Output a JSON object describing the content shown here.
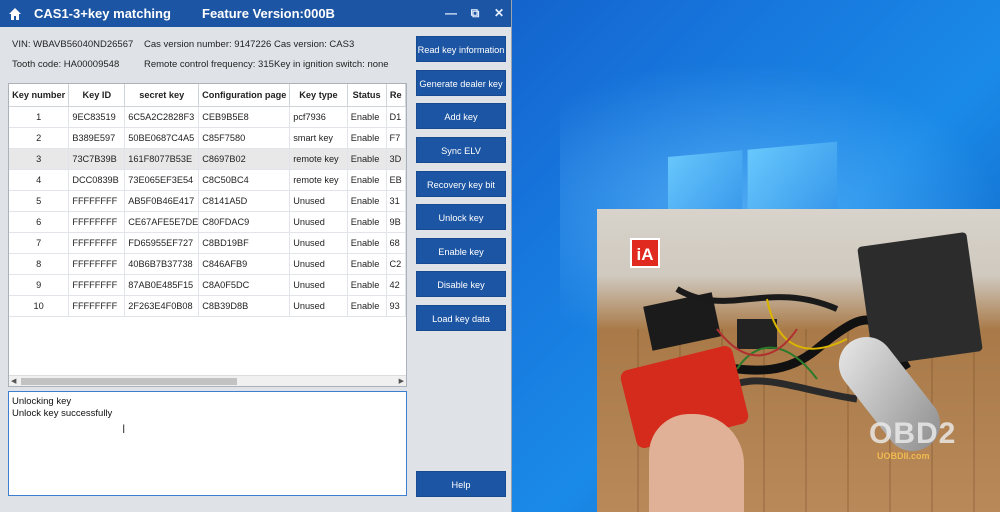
{
  "titlebar": {
    "title": "CAS1-3+key matching",
    "feature": "Feature Version:000B",
    "home_icon": "home-icon",
    "min": "—",
    "restore": "⧉",
    "close": "✕"
  },
  "info": {
    "vin": "VIN: WBAVB56040ND26567",
    "cas_version_number": "Cas version number: 9147226",
    "cas_version": "Cas version: CAS3",
    "tooth_code": "Tooth code: HA00009548",
    "remote_freq": "Remote control frequency: 315",
    "key_in_ignition": "Key in ignition switch: none"
  },
  "table": {
    "columns": [
      "Key number",
      "Key ID",
      "secret key",
      "Configuration page",
      "Key type",
      "Status",
      "Re"
    ],
    "rows": [
      [
        "1",
        "9EC83519",
        "6C5A2C2828F3",
        "CEB9B5E8",
        "pcf7936",
        "Enable",
        "D1"
      ],
      [
        "2",
        "B389E597",
        "50BE0687C4A5",
        "C85F7580",
        "smart key",
        "Enable",
        "F7"
      ],
      [
        "3",
        "73C7B39B",
        "161F8077B53E",
        "C8697B02",
        "remote key",
        "Enable",
        "3D"
      ],
      [
        "4",
        "DCC0839B",
        "73E065EF3E54",
        "C8C50BC4",
        "remote key",
        "Enable",
        "EB"
      ],
      [
        "5",
        "FFFFFFFF",
        "AB5F0B46E417",
        "C8141A5D",
        "Unused",
        "Enable",
        "31"
      ],
      [
        "6",
        "FFFFFFFF",
        "CE67AFE5E7DE",
        "C80FDAC9",
        "Unused",
        "Enable",
        "9B"
      ],
      [
        "7",
        "FFFFFFFF",
        "FD65955EF727",
        "C8BD19BF",
        "Unused",
        "Enable",
        "68"
      ],
      [
        "8",
        "FFFFFFFF",
        "40B6B7B37738",
        "C846AFB9",
        "Unused",
        "Enable",
        "C2"
      ],
      [
        "9",
        "FFFFFFFF",
        "87AB0E485F15",
        "C8A0F5DC",
        "Unused",
        "Enable",
        "42"
      ],
      [
        "10",
        "FFFFFFFF",
        "2F263E4F0B08",
        "C8B39D8B",
        "Unused",
        "Enable",
        "93"
      ]
    ],
    "selected_row": 3
  },
  "log": {
    "lines": [
      "Unlocking key",
      "Unlock key successfully"
    ],
    "cursor": "I"
  },
  "buttons": {
    "read_key_info": "Read key information",
    "generate_dealer_key": "Generate dealer key",
    "add_key": "Add key",
    "sync_elv": "Sync ELV",
    "recovery_key_bit": "Recovery key bit",
    "unlock_key": "Unlock key",
    "enable_key": "Enable key",
    "disable_key": "Disable key",
    "load_key_data": "Load key data",
    "help": "Help"
  },
  "video": {
    "logo_text": "iA",
    "watermark": "OBD2",
    "watermark_sub": "UOBDII.com"
  },
  "colors": {
    "accent": "#1c55a3",
    "desktop": "#1670d8"
  }
}
